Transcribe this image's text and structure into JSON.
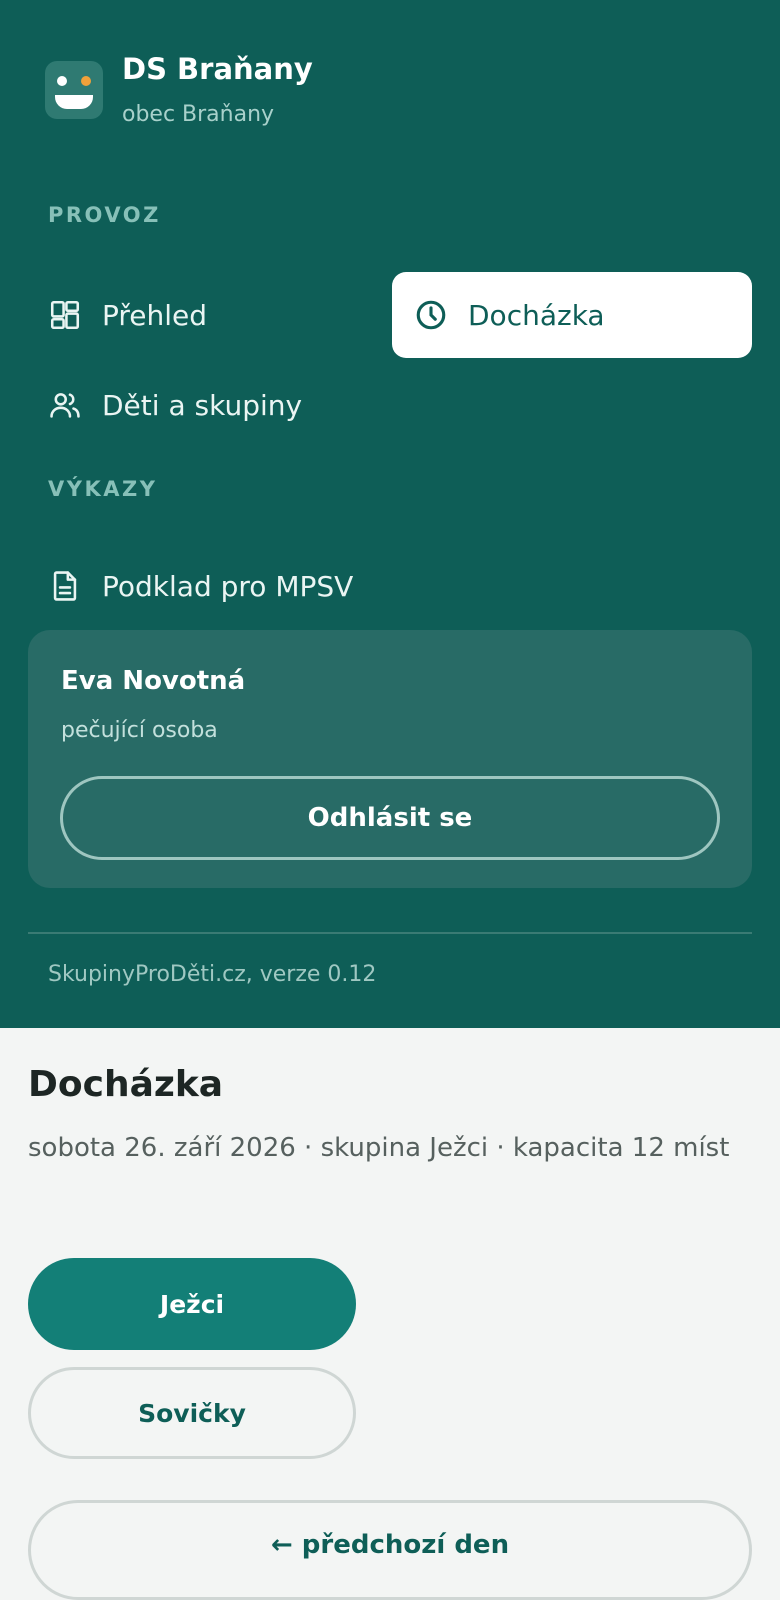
{
  "brand": {
    "name": "DS Braňany",
    "subtitle": "obec Braňany"
  },
  "nav": {
    "section_provoz": "PROVOZ",
    "section_vykazy": "VÝKAZY",
    "items": [
      {
        "label": "Přehled",
        "icon": "dashboard-icon",
        "active": false
      },
      {
        "label": "Docházka",
        "icon": "clock-icon",
        "active": true
      },
      {
        "label": "Děti a skupiny",
        "icon": "users-icon",
        "active": false
      },
      {
        "label": "Podklad pro MPSV",
        "icon": "document-icon",
        "active": false
      }
    ]
  },
  "user": {
    "name": "Eva Novotná",
    "role": "pečující osoba",
    "logout_label": "Odhlásit se"
  },
  "footer": {
    "version": "SkupinyProDěti.cz, verze 0.12"
  },
  "page": {
    "title": "Docházka",
    "subtitle": "sobota 26. září 2026 · skupina Ježci · kapacita 12 míst"
  },
  "groups": [
    {
      "label": "Ježci",
      "active": true
    },
    {
      "label": "Sovičky",
      "active": false
    }
  ],
  "prev_day_label": "← předchozí den",
  "colors": {
    "sidebar_bg": "#0e5e57",
    "accent": "#137f77",
    "logo_eye_accent": "#f0a13a"
  }
}
